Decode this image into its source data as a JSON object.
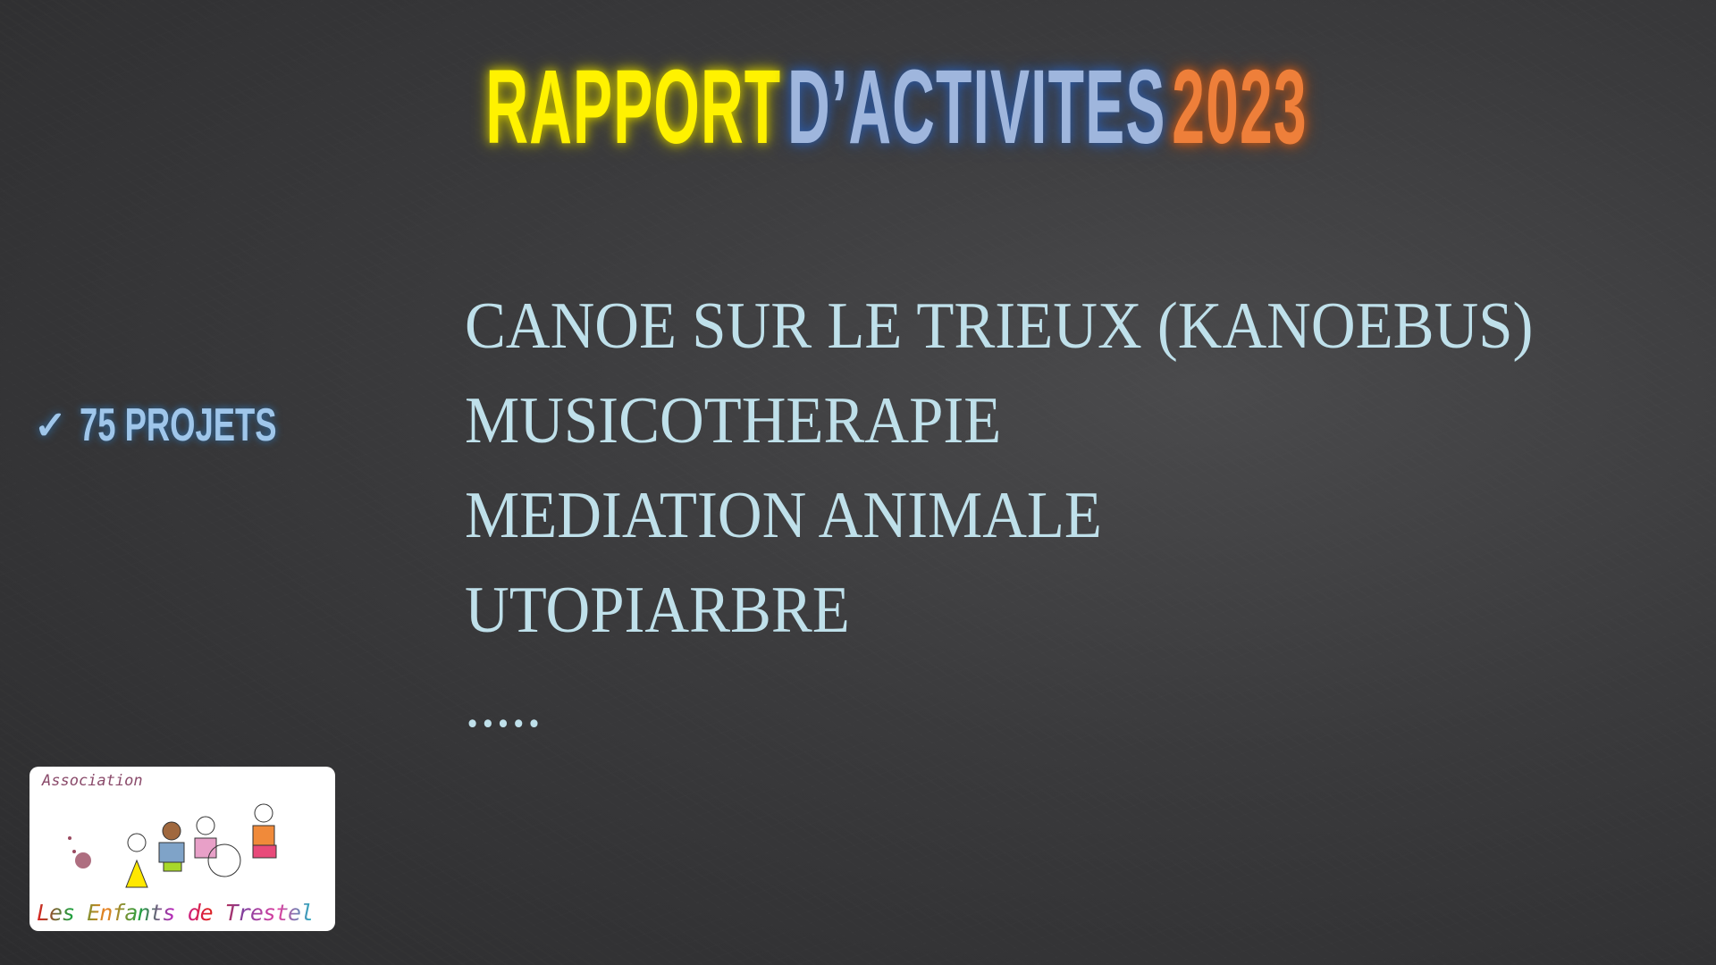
{
  "title": {
    "part1": "RAPPORT",
    "part2": "D’ACTIVITES",
    "part3": "2023",
    "colors": {
      "part1": "#fff200",
      "part2": "#9fb6dd",
      "part3": "#ee7f3a"
    }
  },
  "badge": {
    "icon": "check-icon",
    "label": "75 PROJETS"
  },
  "activities": [
    "CANOE SUR LE TRIEUX (KANOEBUS)",
    "MUSICOTHERAPIE",
    "MEDIATION ANIMALE",
    "UTOPIARBRE",
    "....."
  ],
  "logo": {
    "top": "Association",
    "name": "Les Enfants de Trestel"
  }
}
